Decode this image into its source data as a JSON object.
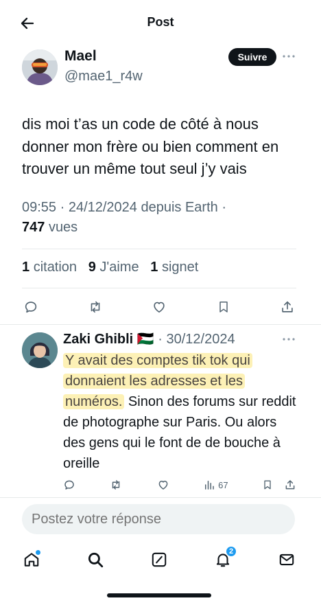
{
  "header": {
    "title": "Post"
  },
  "post": {
    "author_name": "Mael",
    "author_handle": "@mae1_r4w",
    "follow_label": "Suivre",
    "text": "dis moi t’as un code de côté à nous donner mon frère ou bien comment en trouver un même tout seul j’y vais",
    "meta": "09:55 · 24/12/2024 depuis Earth ·",
    "views_count": "747",
    "views_label": "vues",
    "stats": {
      "citation_count": "1",
      "citation_label": "citation",
      "likes_count": "9",
      "likes_label": "J'aime",
      "bookmarks_count": "1",
      "bookmarks_label": "signet"
    }
  },
  "reply": {
    "author_name": "Zaki Ghibli",
    "flag": "🇵🇸",
    "date": "· 30/12/2024",
    "text_highlighted": "Y avait des comptes tik tok qui donnaient les adresses et les numéros.",
    "text_rest": " Sinon des forums sur reddit de photographe sur Paris. Ou alors des gens qui le font de de bouche à oreille",
    "views_count": "67"
  },
  "composer": {
    "placeholder": "Postez votre réponse"
  },
  "tabbar": {
    "notifications_badge": "2"
  },
  "icons": {
    "back": "arrow-left-icon",
    "more": "more-horizontal-icon",
    "reply": "reply-icon",
    "repost": "repost-icon",
    "like": "heart-icon",
    "bookmark": "bookmark-icon",
    "share": "share-icon",
    "views": "analytics-icon",
    "home": "home-icon",
    "search": "search-icon",
    "grok": "grok-icon",
    "notifications": "bell-icon",
    "messages": "mail-icon"
  },
  "colors": {
    "highlight": "#fdf1b6",
    "accent": "#1d9bf0",
    "text": "#0f1419",
    "muted": "#536471"
  }
}
